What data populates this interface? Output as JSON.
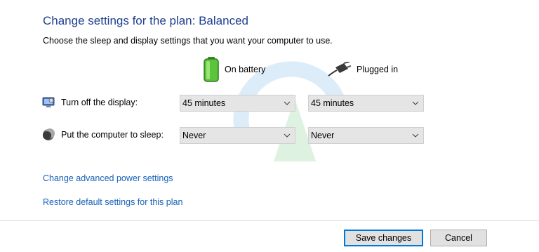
{
  "page": {
    "title": "Change settings for the plan: Balanced",
    "subtitle": "Choose the sleep and display settings that you want your computer to use."
  },
  "columns": {
    "on_battery": "On battery",
    "plugged_in": "Plugged in"
  },
  "rows": {
    "display": {
      "label": "Turn off the display:",
      "on_battery": "45 minutes",
      "plugged_in": "45 minutes"
    },
    "sleep": {
      "label": "Put the computer to sleep:",
      "on_battery": "Never",
      "plugged_in": "Never"
    }
  },
  "links": {
    "advanced": "Change advanced power settings",
    "restore": "Restore default settings for this plan"
  },
  "buttons": {
    "save": "Save changes",
    "cancel": "Cancel"
  },
  "colors": {
    "title": "#1f3f8f",
    "link": "#1660b8",
    "select_bg": "#e5e5e5",
    "accent": "#0078d7"
  },
  "icons": {
    "battery": "battery-icon",
    "plug": "plug-icon",
    "display": "monitor-icon",
    "sleep": "moon-icon",
    "chevron": "chevron-down-icon"
  }
}
